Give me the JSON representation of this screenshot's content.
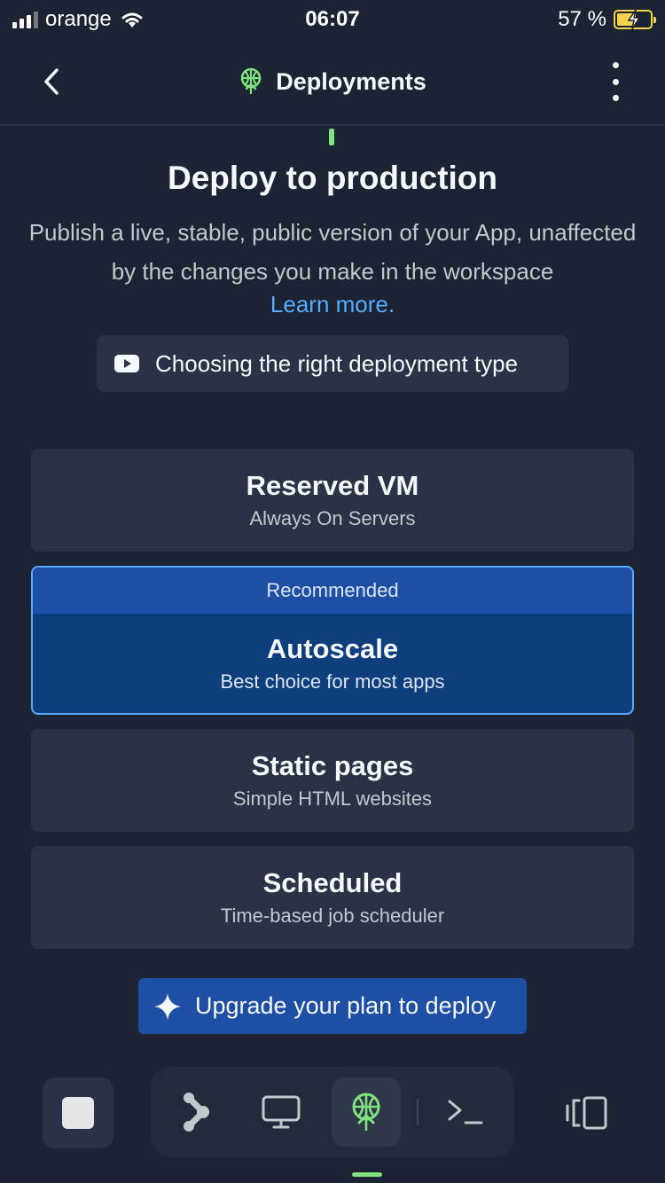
{
  "status_bar": {
    "carrier": "orange",
    "time": "06:07",
    "battery": "57 %",
    "battery_level": 0.57
  },
  "header": {
    "title": "Deployments",
    "icons": {
      "back": "chevron-left-icon",
      "title": "deploy-antenna-icon",
      "menu": "kebab-menu-icon"
    }
  },
  "hero": {
    "title": "Deploy to production",
    "description": "Publish a live, stable, public version of your App, unaffected by the changes you make in the workspace",
    "learn_more": "Learn more.",
    "video_link": "Choosing the right deployment type"
  },
  "options": {
    "reserved": {
      "name": "Reserved VM",
      "desc": "Always On Servers"
    },
    "autoscale": {
      "badge": "Recommended",
      "name": "Autoscale",
      "desc": "Best choice for most apps",
      "selected": true
    },
    "static": {
      "name": "Static pages",
      "desc": "Simple HTML websites"
    },
    "scheduled": {
      "name": "Scheduled",
      "desc": "Time-based job scheduler"
    }
  },
  "upgrade_button": "Upgrade your plan to deploy",
  "bottom_bar": {
    "tools": [
      "stop-icon",
      "agent-icon",
      "webview-icon",
      "deployments-icon",
      "terminal-icon",
      "panels-icon"
    ],
    "active": "deployments-icon"
  },
  "colors": {
    "background": "#1c2333",
    "card": "#2b3245",
    "accent_blue": "#1f4fa5",
    "link_blue": "#57abff",
    "accent_green": "#7fe37f",
    "battery_yellow": "#f6d34a"
  }
}
